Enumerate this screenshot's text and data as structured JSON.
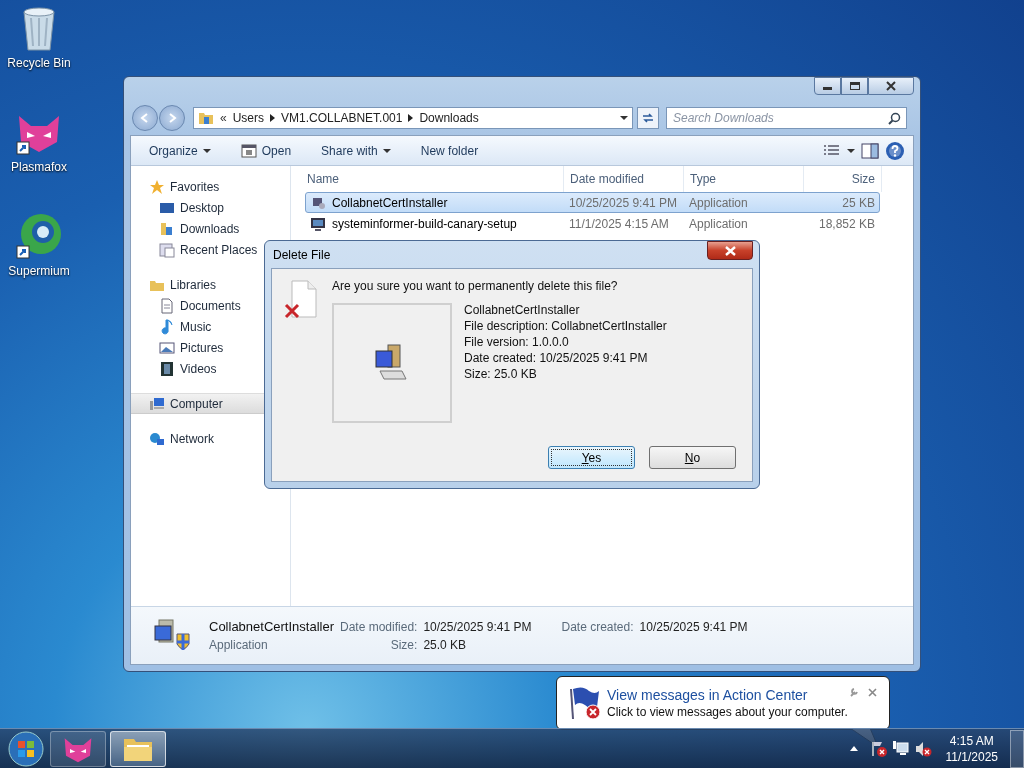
{
  "desktop_icons": [
    {
      "label": "Recycle Bin",
      "kind": "bin"
    },
    {
      "label": "Plasmafox",
      "kind": "fox"
    },
    {
      "label": "Supermium",
      "kind": "globe"
    }
  ],
  "explorer": {
    "address": {
      "overflow": "«",
      "crumbs": [
        "Users",
        "VM1.COLLABNET.001",
        "Downloads"
      ]
    },
    "search": {
      "placeholder": "Search Downloads"
    },
    "toolbar": [
      {
        "label": "Organize",
        "dropdown": true,
        "kind": "text"
      },
      {
        "label": "Open",
        "dropdown": false,
        "kind": "open"
      },
      {
        "label": "Share with",
        "dropdown": true,
        "kind": "text"
      },
      {
        "label": "New folder",
        "dropdown": false,
        "kind": "text"
      }
    ],
    "nav": [
      {
        "label": "Favorites",
        "kind": "star",
        "selected": false,
        "children": [
          {
            "label": "Desktop",
            "kind": "desktop",
            "selected": false
          },
          {
            "label": "Downloads",
            "kind": "downloads",
            "selected": false
          },
          {
            "label": "Recent Places",
            "kind": "recent",
            "selected": false
          }
        ]
      },
      {
        "label": "Libraries",
        "kind": "library",
        "selected": false,
        "children": [
          {
            "label": "Documents",
            "kind": "document",
            "selected": false
          },
          {
            "label": "Music",
            "kind": "music",
            "selected": false
          },
          {
            "label": "Pictures",
            "kind": "pictures",
            "selected": false
          },
          {
            "label": "Videos",
            "kind": "videos",
            "selected": false
          }
        ]
      },
      {
        "label": "Computer",
        "kind": "computer",
        "selected": true
      },
      {
        "label": "Network",
        "kind": "network",
        "selected": false
      }
    ],
    "columns": [
      "Name",
      "Date modified",
      "Type",
      "Size"
    ],
    "rows": [
      {
        "name": "CollabnetCertInstaller",
        "date": "10/25/2025 9:41 PM",
        "type": "Application",
        "size": "25 KB",
        "selected": true
      },
      {
        "name": "systeminformer-build-canary-setup",
        "date": "11/1/2025 4:15 AM",
        "type": "Application",
        "size": "18,852 KB",
        "selected": false
      }
    ],
    "details": {
      "name": "CollabnetCertInstaller",
      "type": "Application",
      "fields": [
        {
          "label": "Date modified:",
          "value": "10/25/2025 9:41 PM"
        },
        {
          "label": "Date created:",
          "value": "10/25/2025 9:41 PM"
        },
        {
          "label": "Size:",
          "value": "25.0 KB"
        }
      ]
    }
  },
  "dialog": {
    "title": "Delete File",
    "question": "Are you sure you want to permanently delete this file?",
    "info": [
      "CollabnetCertInstaller",
      "File description: CollabnetCertInstaller",
      "File version: 1.0.0.0",
      "Date created: 10/25/2025 9:41 PM",
      "Size: 25.0 KB"
    ],
    "buttons": [
      {
        "label": "Yes",
        "default": true
      },
      {
        "label": "No",
        "default": false
      }
    ]
  },
  "balloon": {
    "title": "View messages in Action Center",
    "message": "Click to view messages about your computer."
  },
  "taskbar": {
    "apps": [
      {
        "kind": "fox",
        "selected": false
      },
      {
        "kind": "folder",
        "selected": true
      }
    ],
    "time": "4:15 AM",
    "date": "11/1/2025"
  }
}
